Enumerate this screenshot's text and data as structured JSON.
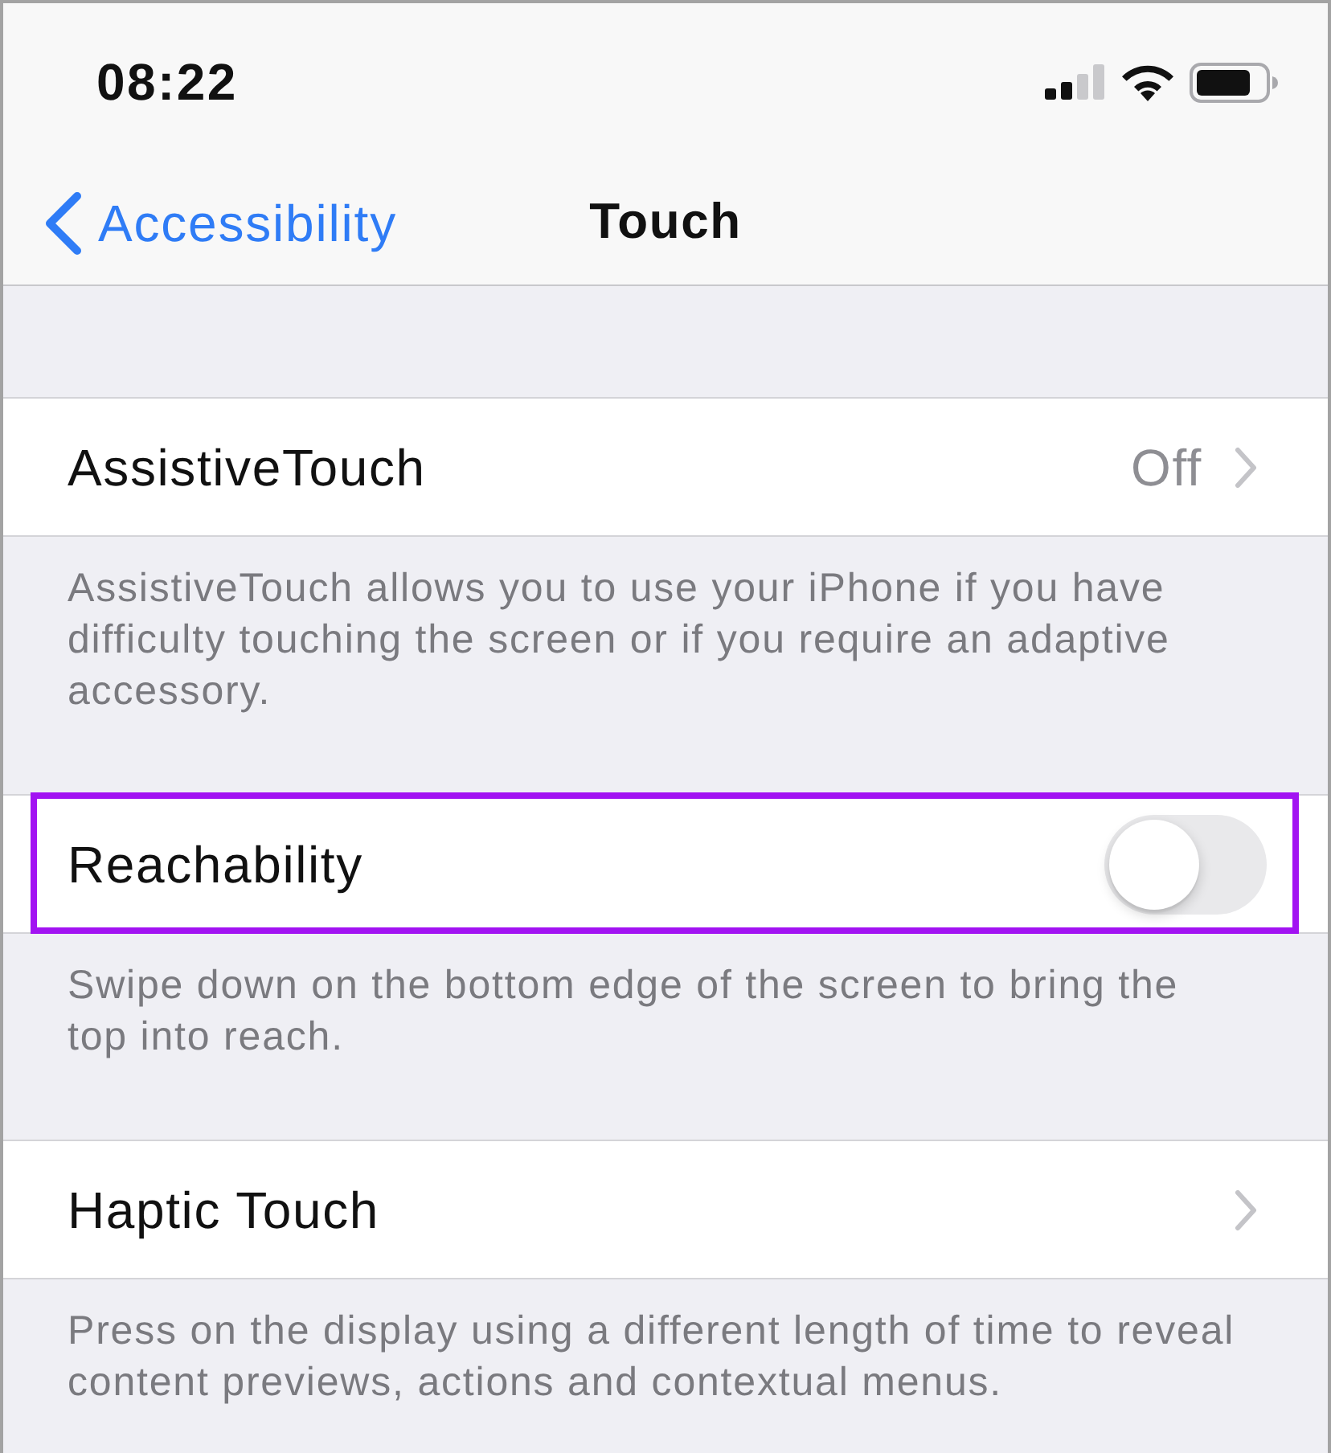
{
  "status_bar": {
    "time": "08:22"
  },
  "nav_bar": {
    "back_label": "Accessibility",
    "title": "Touch"
  },
  "sections": [
    {
      "row": {
        "kind": "disclosure",
        "label": "AssistiveTouch",
        "value": "Off",
        "highlighted": false
      },
      "footer": "AssistiveTouch allows you to use your iPhone if you have difficulty touching the screen or if you require an adaptive accessory."
    },
    {
      "row": {
        "kind": "toggle",
        "label": "Reachability",
        "on": false,
        "highlighted": true
      },
      "footer": "Swipe down on the bottom edge of the screen to bring the top into reach."
    },
    {
      "row": {
        "kind": "disclosure",
        "label": "Haptic Touch",
        "highlighted": false
      },
      "footer": "Press on the display using a different length of time to reveal content previews, actions and contextual menus."
    }
  ]
}
